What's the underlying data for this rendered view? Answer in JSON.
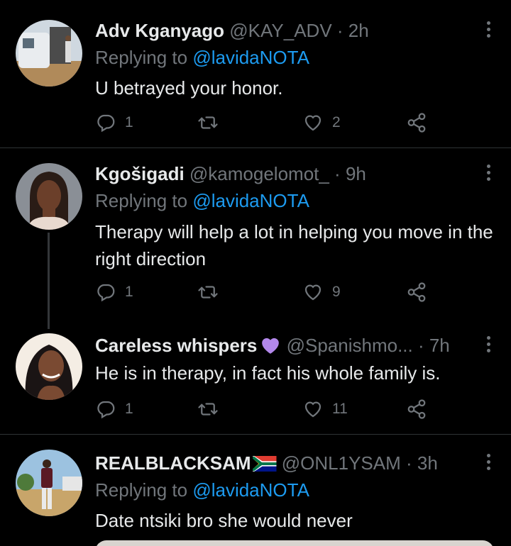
{
  "tweets": [
    {
      "name": "Adv Kganyago",
      "meta": "@KAY_ADV · 2h",
      "replying_prefix": "Replying to",
      "replying_handle": "@lavidaNOTA",
      "text": "U betrayed your honor.",
      "reply_count": "1",
      "retweet_count": "",
      "like_count": "2"
    },
    {
      "name": "Kgošigadi",
      "meta": "@kamogelomot_ · 9h",
      "replying_prefix": "Replying to",
      "replying_handle": "@lavidaNOTA",
      "text": "Therapy will help a lot in helping you move in the right direction",
      "reply_count": "1",
      "retweet_count": "",
      "like_count": "9"
    },
    {
      "name": "Careless whispers",
      "meta": "@Spanishmo... · 7h",
      "text": "He is in therapy, in fact his whole family is.",
      "reply_count": "1",
      "retweet_count": "",
      "like_count": "11"
    },
    {
      "name": "REALBLACKSAM",
      "meta": "@ONL1YSAM · 3h",
      "replying_prefix": "Replying to",
      "replying_handle": "@lavidaNOTA",
      "text": "Date ntsiki bro she would never"
    }
  ],
  "icons": {
    "reply": "reply-icon",
    "retweet": "retweet-icon",
    "like": "heart-icon",
    "share": "share-icon",
    "more": "more-options-icon",
    "emoji_heart": "purple-heart-emoji",
    "flag": "south-africa-flag"
  },
  "colors": {
    "background": "#000000",
    "text": "#e7e9ea",
    "muted": "#71767b",
    "link": "#1d9bf0",
    "divider": "#2f3336",
    "emoji_heart": "#b388eb"
  }
}
